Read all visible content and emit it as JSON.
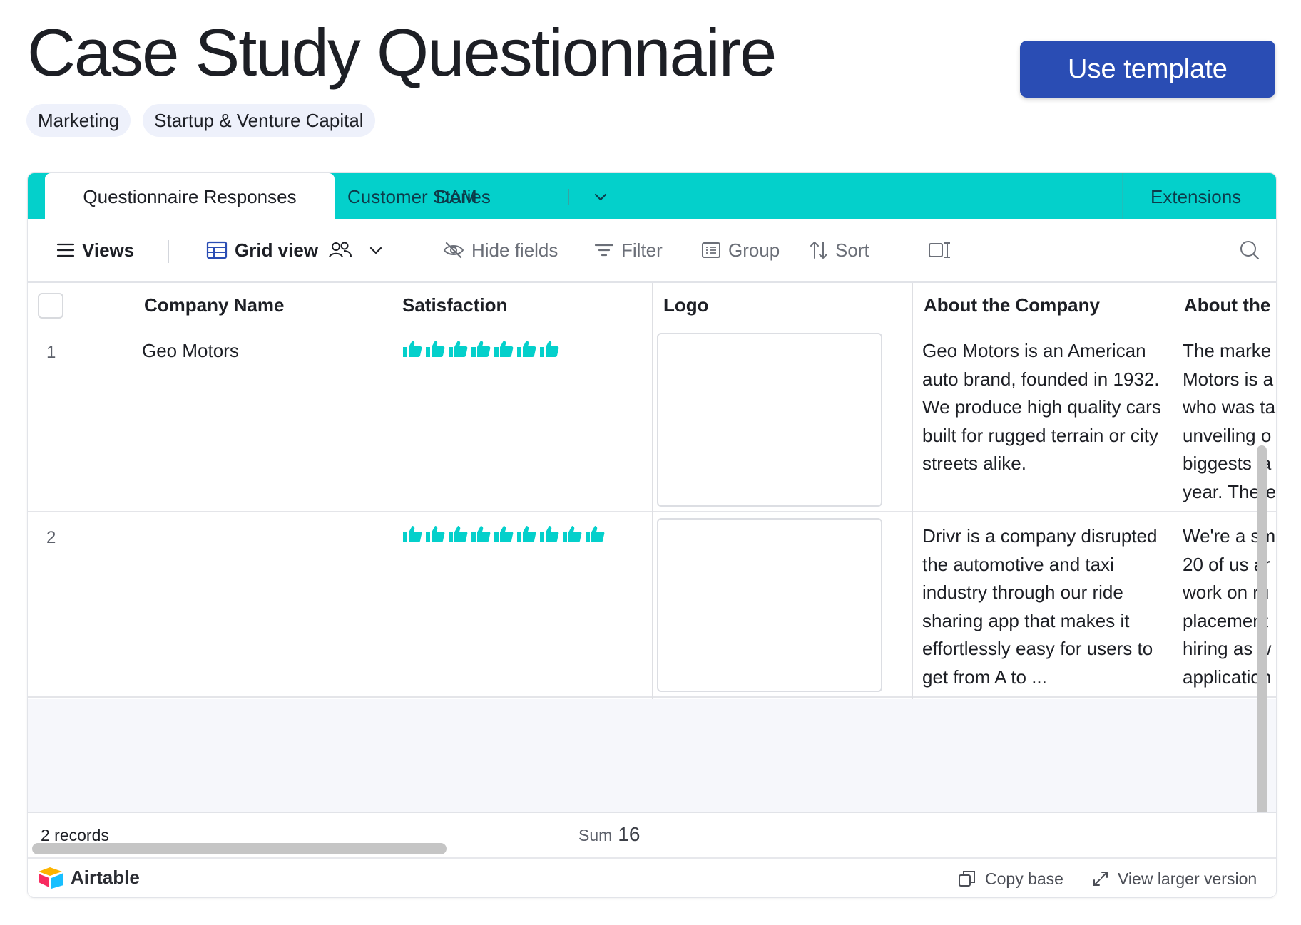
{
  "page": {
    "title": "Case Study Questionnaire",
    "use_template_label": "Use template",
    "tags": [
      "Marketing",
      "Startup & Venture Capital"
    ]
  },
  "tabs": {
    "active": "Questionnaire Responses",
    "items": [
      "Customer Stories",
      "DAM"
    ],
    "extensions": "Extensions"
  },
  "toolbar": {
    "views": "Views",
    "grid_view": "Grid view",
    "hide_fields": "Hide fields",
    "filter": "Filter",
    "group": "Group",
    "sort": "Sort"
  },
  "columns": [
    "Company Name",
    "Satisfaction",
    "Logo",
    "About the Company",
    "About the"
  ],
  "rows": [
    {
      "num": "1",
      "company": "Geo Motors",
      "satisfaction": 7,
      "about_company": "Geo Motors is an American auto brand, founded in 1932. We produce high quality cars built for rugged terrain or city streets alike.",
      "about_the": [
        "The marke",
        "Motors is a",
        "who was ta",
        "unveiling o",
        "biggests la",
        "year. There"
      ]
    },
    {
      "num": "2",
      "company": "",
      "satisfaction": 9,
      "about_company": "Drivr is a company disrupted the automotive and taxi industry through our ride sharing app that makes it effortlessly easy for users to get from A to ...",
      "about_the": [
        "We're a sm",
        "20 of us ar",
        "work on ru",
        "placement",
        "hiring as w",
        "application"
      ]
    }
  ],
  "summary": {
    "records": "2 records",
    "sum_label": "Sum",
    "sum_value": "16"
  },
  "footer": {
    "brand": "Airtable",
    "copy_base": "Copy base",
    "view_larger": "View larger version"
  },
  "colors": {
    "accent_teal": "#04d0cb",
    "button_blue": "#2a4db4"
  }
}
